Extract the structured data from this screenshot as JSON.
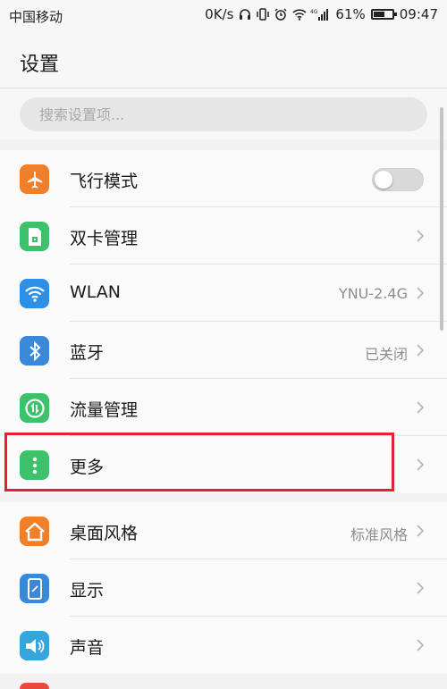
{
  "status_bar": {
    "carrier": "中国移动",
    "speed": "0K/s",
    "network": "4G",
    "battery": "61%",
    "battery_level": 0.61,
    "time": "09:47"
  },
  "header": {
    "title": "设置"
  },
  "search": {
    "placeholder": "搜索设置项..."
  },
  "colors": {
    "airplane": "#f07f2c",
    "sim": "#3dc16b",
    "wlan": "#2e8fe6",
    "bluetooth": "#3a88d8",
    "data_usage": "#3dc16b",
    "more": "#3dc16b",
    "theme": "#f07f2c",
    "display": "#3a88d8",
    "sound": "#36a5dc",
    "highlight": "#e0232d"
  },
  "group1": [
    {
      "label": "飞行模式",
      "icon": "airplane-icon",
      "toggle": false
    },
    {
      "label": "双卡管理",
      "icon": "sim-card-icon",
      "value": ""
    },
    {
      "label": "WLAN",
      "icon": "wifi-icon",
      "value": "YNU-2.4G"
    },
    {
      "label": "蓝牙",
      "icon": "bluetooth-icon",
      "value": "已关闭"
    },
    {
      "label": "流量管理",
      "icon": "data-usage-icon",
      "value": ""
    },
    {
      "label": "更多",
      "icon": "more-icon",
      "value": ""
    }
  ],
  "group2": [
    {
      "label": "桌面风格",
      "icon": "home-icon",
      "value": "标准风格"
    },
    {
      "label": "显示",
      "icon": "display-icon",
      "value": ""
    },
    {
      "label": "声音",
      "icon": "sound-icon",
      "value": ""
    }
  ]
}
